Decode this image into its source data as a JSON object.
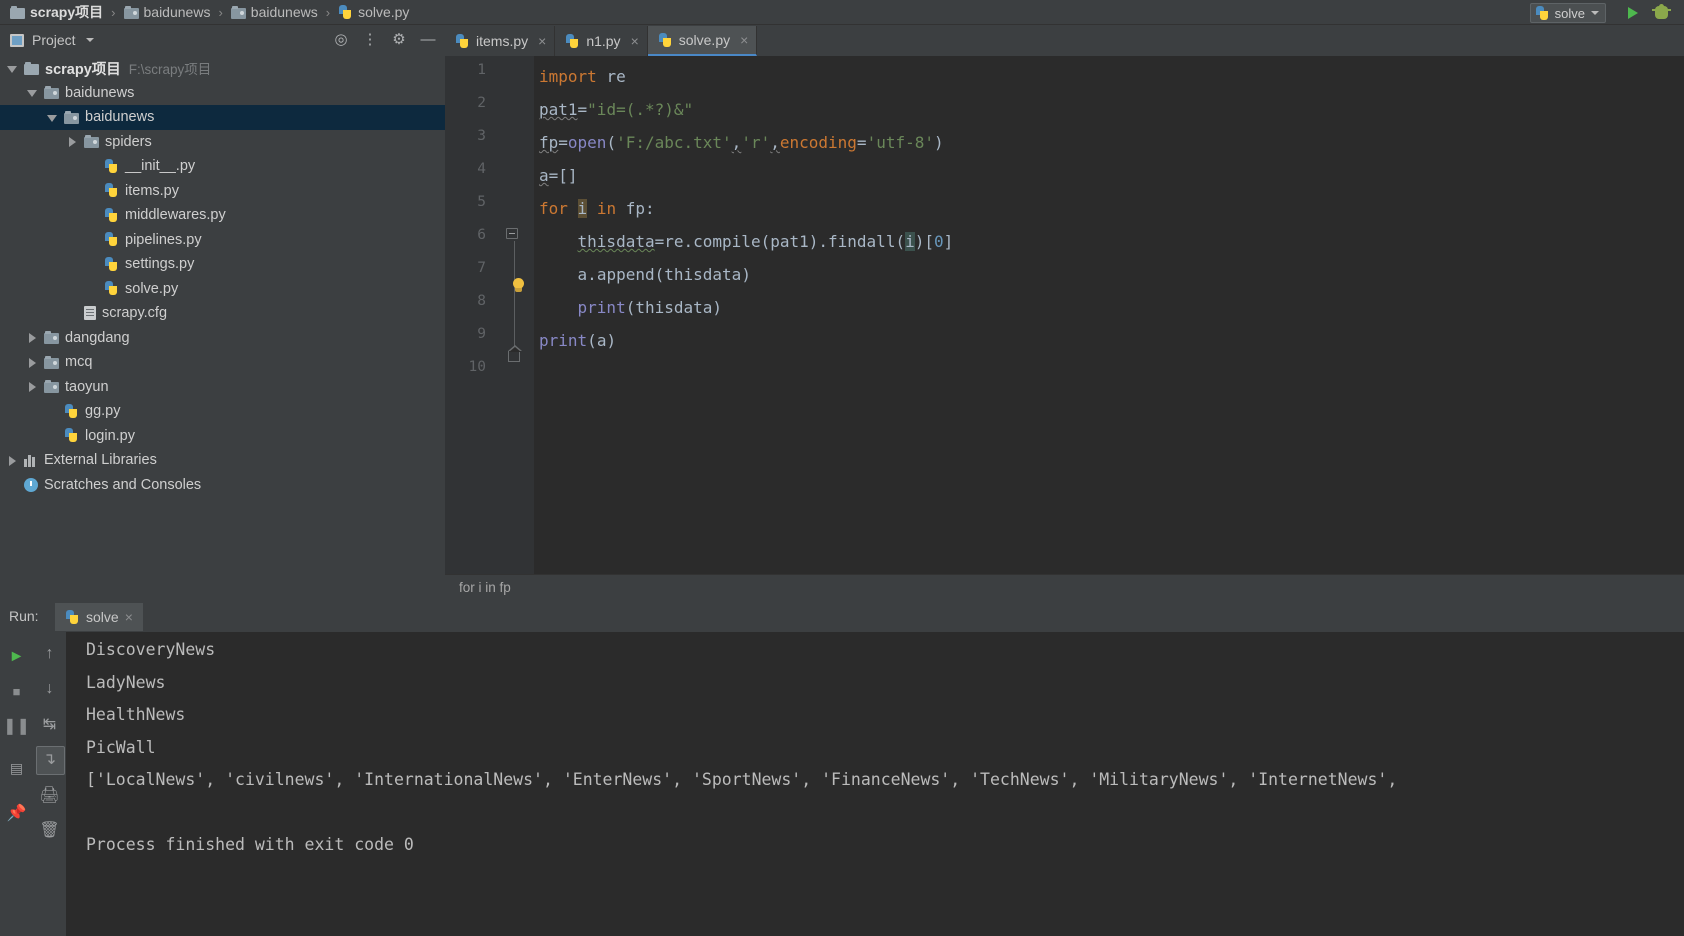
{
  "window": {
    "breadcrumb": [
      {
        "label": "scrapy项目",
        "icon": "folder-icon",
        "bold": true
      },
      {
        "label": "baidunews",
        "icon": "folder-src-icon",
        "bold": false
      },
      {
        "label": "baidunews",
        "icon": "folder-src-icon",
        "bold": false
      },
      {
        "label": "solve.py",
        "icon": "python-file-icon",
        "bold": false
      }
    ],
    "run_config": {
      "name": "solve",
      "icon": "python-file-icon"
    },
    "run_button": "run-icon",
    "debug_button": "debug-icon"
  },
  "project_panel": {
    "title": "Project",
    "icons": [
      "target-icon",
      "collapse-all-icon",
      "gear-icon",
      "minimize-icon"
    ],
    "tree": [
      {
        "label": "scrapy项目",
        "path": "F:\\scrapy项目",
        "indent": 0,
        "arrow": "down",
        "icon": "folder-icon",
        "bold": true,
        "selected": false
      },
      {
        "label": "baidunews",
        "path": "",
        "indent": 1,
        "arrow": "down",
        "icon": "folder-src-icon",
        "bold": false,
        "selected": false
      },
      {
        "label": "baidunews",
        "path": "",
        "indent": 2,
        "arrow": "down",
        "icon": "folder-src-icon",
        "bold": false,
        "selected": true
      },
      {
        "label": "spiders",
        "path": "",
        "indent": 3,
        "arrow": "right",
        "icon": "folder-src-icon",
        "bold": false,
        "selected": false
      },
      {
        "label": "__init__.py",
        "path": "",
        "indent": 4,
        "arrow": "none",
        "icon": "python-file-icon",
        "bold": false,
        "selected": false
      },
      {
        "label": "items.py",
        "path": "",
        "indent": 4,
        "arrow": "none",
        "icon": "python-file-icon",
        "bold": false,
        "selected": false
      },
      {
        "label": "middlewares.py",
        "path": "",
        "indent": 4,
        "arrow": "none",
        "icon": "python-file-icon",
        "bold": false,
        "selected": false
      },
      {
        "label": "pipelines.py",
        "path": "",
        "indent": 4,
        "arrow": "none",
        "icon": "python-file-icon",
        "bold": false,
        "selected": false
      },
      {
        "label": "settings.py",
        "path": "",
        "indent": 4,
        "arrow": "none",
        "icon": "python-file-icon",
        "bold": false,
        "selected": false
      },
      {
        "label": "solve.py",
        "path": "",
        "indent": 4,
        "arrow": "none",
        "icon": "python-file-icon",
        "bold": false,
        "selected": false
      },
      {
        "label": "scrapy.cfg",
        "path": "",
        "indent": 3,
        "arrow": "none",
        "icon": "config-file-icon",
        "bold": false,
        "selected": false
      },
      {
        "label": "dangdang",
        "path": "",
        "indent": 1,
        "arrow": "right",
        "icon": "folder-src-icon",
        "bold": false,
        "selected": false
      },
      {
        "label": "mcq",
        "path": "",
        "indent": 1,
        "arrow": "right",
        "icon": "folder-src-icon",
        "bold": false,
        "selected": false
      },
      {
        "label": "taoyun",
        "path": "",
        "indent": 1,
        "arrow": "right",
        "icon": "folder-src-icon",
        "bold": false,
        "selected": false
      },
      {
        "label": "gg.py",
        "path": "",
        "indent": 2,
        "arrow": "none",
        "icon": "python-file-icon",
        "bold": false,
        "selected": false
      },
      {
        "label": "login.py",
        "path": "",
        "indent": 2,
        "arrow": "none",
        "icon": "python-file-icon",
        "bold": false,
        "selected": false
      },
      {
        "label": "External Libraries",
        "path": "",
        "indent": 0,
        "arrow": "right",
        "icon": "library-icon",
        "bold": false,
        "selected": false
      },
      {
        "label": "Scratches and Consoles",
        "path": "",
        "indent": 0,
        "arrow": "none",
        "icon": "scratches-icon",
        "bold": false,
        "selected": false
      }
    ]
  },
  "editor": {
    "tabs": [
      {
        "label": "items.py",
        "icon": "python-file-icon",
        "active": false,
        "close": "×"
      },
      {
        "label": "n1.py",
        "icon": "python-file-icon",
        "active": false,
        "close": "×"
      },
      {
        "label": "solve.py",
        "icon": "python-file-icon",
        "active": true,
        "close": "×"
      }
    ],
    "line_numbers": [
      "1",
      "2",
      "3",
      "4",
      "5",
      "6",
      "7",
      "8",
      "9",
      "10"
    ],
    "lines": [
      "import re",
      "pat1=\"id=(.*?)&\"",
      "fp=open('F:/abc.txt','r',encoding='utf-8')",
      "a=[]",
      "for i in fp:",
      "    thisdata=re.compile(pat1).findall(i)[0]",
      "    a.append(thisdata)",
      "    print(thisdata)",
      "print(a)",
      ""
    ],
    "breadcrumb": "for i in fp"
  },
  "run_panel": {
    "label": "Run:",
    "tab": {
      "label": "solve",
      "icon": "python-file-icon",
      "close": "×"
    },
    "left_toolbar": [
      "rerun-icon",
      "stop-icon",
      "pause-icon",
      "console-icon",
      "pin-icon"
    ],
    "second_toolbar": [
      "up-arrow-icon",
      "down-arrow-icon",
      "soft-wrap-icon",
      "scroll-to-end-icon",
      "print-icon",
      "trash-icon"
    ],
    "console_lines": [
      "DiscoveryNews",
      "LadyNews",
      "HealthNews",
      "PicWall",
      "['LocalNews', 'civilnews', 'InternationalNews', 'EnterNews', 'SportNews', 'FinanceNews', 'TechNews', 'MilitaryNews', 'InternetNews',",
      "",
      "Process finished with exit code 0"
    ]
  },
  "colors": {
    "background": "#3c3f41",
    "editor_background": "#2b2b2b",
    "selection": "#0d293e",
    "accent": "#4a88c7",
    "keyword": "#cc7832",
    "string": "#6a8759",
    "number": "#6897bb",
    "function": "#ffc66d",
    "text": "#a9b7c6"
  }
}
